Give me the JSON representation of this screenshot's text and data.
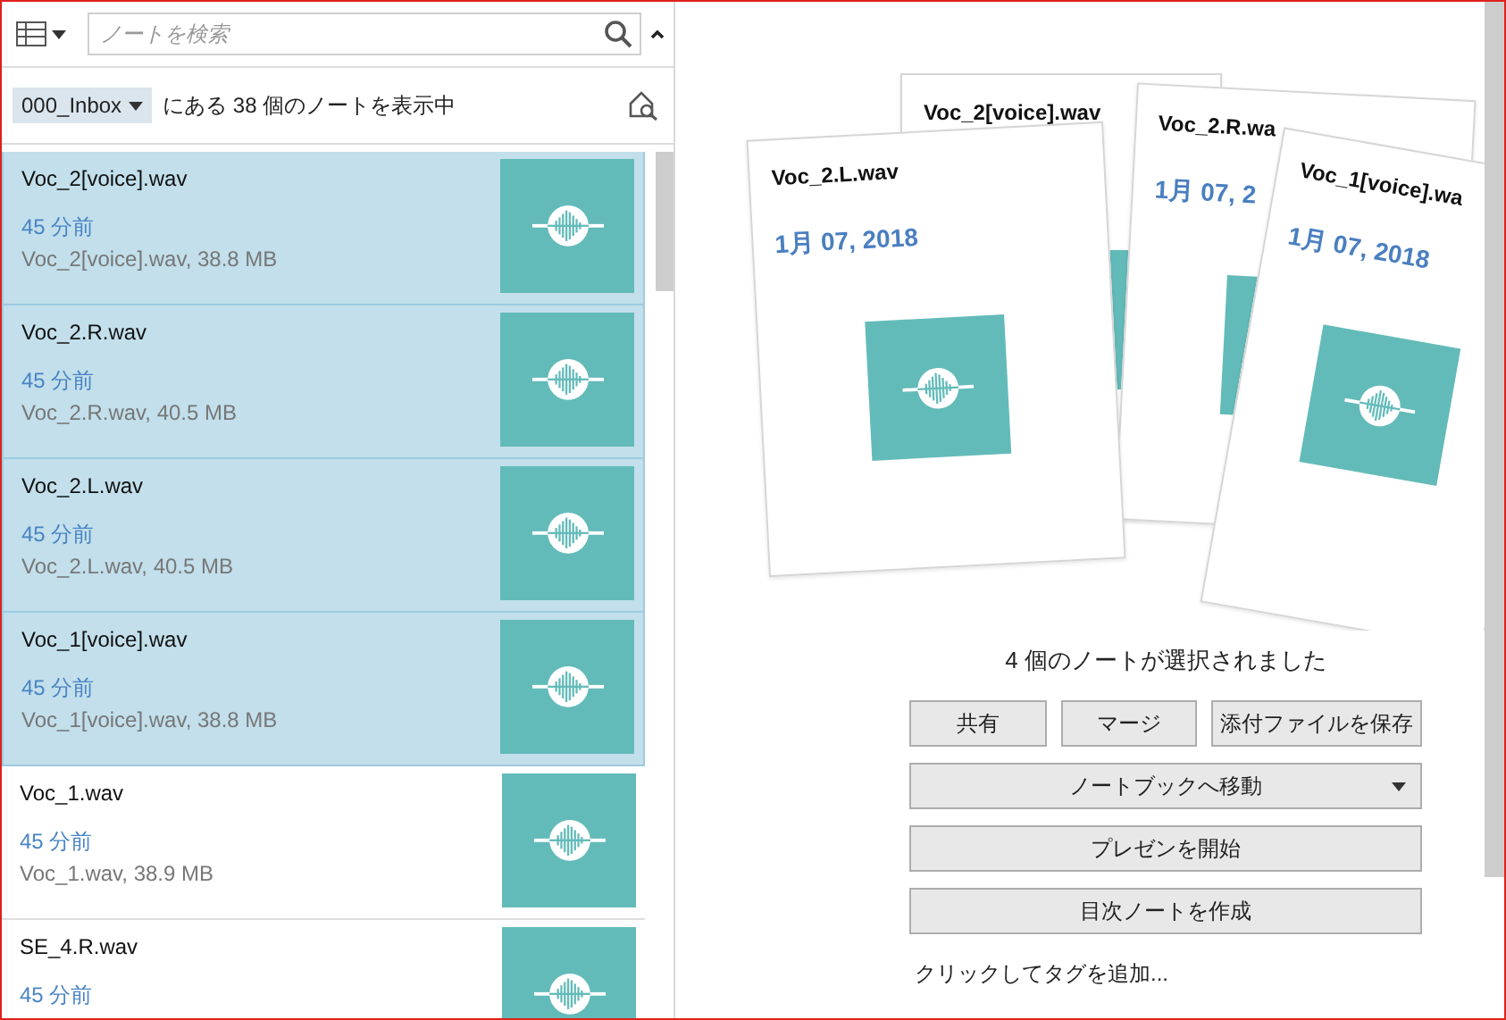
{
  "toolbar": {
    "search": {
      "placeholder": "ノートを検索"
    }
  },
  "notebook_bar": {
    "notebook": "000_Inbox",
    "summary": "にある 38 個のノートを表示中"
  },
  "notes": [
    {
      "title": "Voc_2[voice].wav",
      "time": "45 分前",
      "detail": "Voc_2[voice].wav,  38.8 MB",
      "selected": true
    },
    {
      "title": "Voc_2.R.wav",
      "time": "45 分前",
      "detail": "Voc_2.R.wav,  40.5 MB",
      "selected": true
    },
    {
      "title": "Voc_2.L.wav",
      "time": "45 分前",
      "detail": "Voc_2.L.wav,  40.5 MB",
      "selected": true
    },
    {
      "title": "Voc_1[voice].wav",
      "time": "45 分前",
      "detail": "Voc_1[voice].wav,  38.8 MB",
      "selected": true
    },
    {
      "title": "Voc_1.wav",
      "time": "45 分前",
      "detail": "Voc_1.wav,  38.9 MB",
      "selected": false
    },
    {
      "title": "SE_4.R.wav",
      "time": "45 分前",
      "selected": false
    }
  ],
  "preview": {
    "cards": [
      {
        "title": "Voc_2[voice].wav"
      },
      {
        "title": "Voc_2.R.wa",
        "date": "1月 07, 2"
      },
      {
        "title": "Voc_2.L.wav",
        "date": "1月 07, 2018"
      },
      {
        "title": "Voc_1[voice].wa",
        "date": "1月 07, 2018"
      }
    ],
    "selection_text": "4 個のノートが選択されました",
    "buttons": [
      {
        "label": "共有",
        "kind": "small"
      },
      {
        "label": "マージ",
        "kind": "small"
      },
      {
        "label": "添付ファイルを保存",
        "kind": "small"
      },
      {
        "label": "ノートブックへ移動",
        "kind": "dropdown"
      },
      {
        "label": "プレゼンを開始",
        "kind": "wide"
      },
      {
        "label": "目次ノートを作成",
        "kind": "wide"
      }
    ],
    "tags": {
      "placeholder": "クリックしてタグを追加..."
    }
  }
}
